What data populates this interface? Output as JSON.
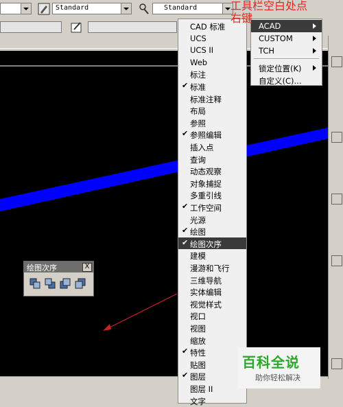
{
  "toolbar": {
    "combo1_value": "Standard",
    "combo2_value": "Standard"
  },
  "annotation": {
    "line1": "工具栏空白处点",
    "line2": "右键"
  },
  "floating_toolbar": {
    "title": "绘图次序",
    "close_label": "X"
  },
  "context_menu": {
    "items": [
      {
        "label": "CAD 标准",
        "checked": false
      },
      {
        "label": "UCS",
        "checked": false
      },
      {
        "label": "UCS II",
        "checked": false
      },
      {
        "label": "Web",
        "checked": false
      },
      {
        "label": "标注",
        "checked": false
      },
      {
        "label": "标准",
        "checked": true
      },
      {
        "label": "标准注释",
        "checked": false
      },
      {
        "label": "布局",
        "checked": false
      },
      {
        "label": "参照",
        "checked": false
      },
      {
        "label": "参照编辑",
        "checked": true
      },
      {
        "label": "插入点",
        "checked": false
      },
      {
        "label": "查询",
        "checked": false
      },
      {
        "label": "动态观察",
        "checked": false
      },
      {
        "label": "对象捕捉",
        "checked": false
      },
      {
        "label": "多重引线",
        "checked": false
      },
      {
        "label": "工作空间",
        "checked": true
      },
      {
        "label": "光源",
        "checked": false
      },
      {
        "label": "绘图",
        "checked": true
      },
      {
        "label": "绘图次序",
        "checked": true,
        "highlighted": true
      },
      {
        "label": "建模",
        "checked": false
      },
      {
        "label": "漫游和飞行",
        "checked": false
      },
      {
        "label": "三维导航",
        "checked": false
      },
      {
        "label": "实体编辑",
        "checked": false
      },
      {
        "label": "视觉样式",
        "checked": false
      },
      {
        "label": "视口",
        "checked": false
      },
      {
        "label": "视图",
        "checked": false
      },
      {
        "label": "缩放",
        "checked": false
      },
      {
        "label": "特性",
        "checked": true
      },
      {
        "label": "贴图",
        "checked": false
      },
      {
        "label": "图层",
        "checked": true
      },
      {
        "label": "图层 II",
        "checked": false
      },
      {
        "label": "文字",
        "checked": false
      }
    ],
    "check_glyph": "✔"
  },
  "submenu": {
    "items": [
      {
        "label": "ACAD",
        "has_arrow": true,
        "highlighted": true
      },
      {
        "label": "CUSTOM",
        "has_arrow": true
      },
      {
        "label": "TCH",
        "has_arrow": true
      },
      {
        "label": "锁定位置(K)",
        "has_arrow": true
      },
      {
        "label": "自定义(C)...",
        "has_arrow": false
      }
    ]
  },
  "watermark": {
    "title": "百科全说",
    "subtitle": "助你轻松解决"
  },
  "colors": {
    "canvas": "#000000",
    "line": "#0000ff",
    "arrow": "#cc2222",
    "annotation": "#e0281e",
    "watermark_green": "#2aa82a"
  }
}
